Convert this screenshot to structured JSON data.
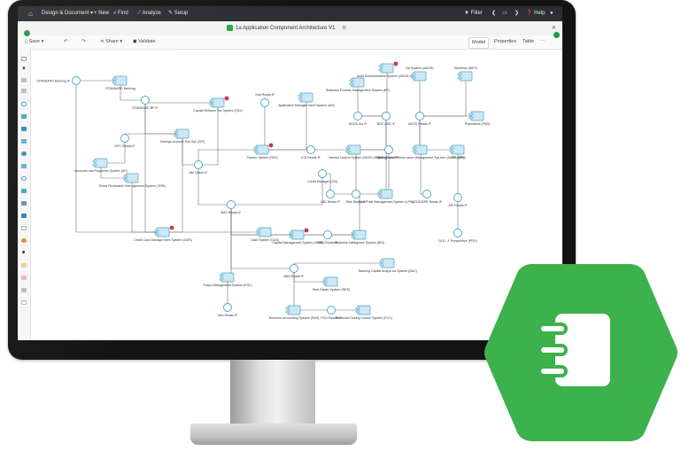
{
  "menu": {
    "design_label": "Design & Document",
    "new_label": "+ New",
    "find_label": "Find",
    "analyze_label": "Analyze",
    "setup_label": "Setup",
    "filter_label": "Filter",
    "help_label": "Help"
  },
  "tab": {
    "title": "1a Application Component Architecture V1"
  },
  "toolbar": {
    "save_label": "Save",
    "share_label": "Share",
    "validate_label": "Validate",
    "views": [
      "Model",
      "Properties",
      "Table"
    ]
  },
  "diagram": {
    "nodes": [
      "STANDARD Banking IF",
      "STANDARD Banking",
      "STANDARD BP IF",
      "Capital Reforms Tax System (TAX)",
      "Application Manager ment System (AM)",
      "Yost Reads IF",
      "Audit Documentation System (ADOS-AUD)",
      "Business Process Management System (BP)",
      "BA System (ADOS)",
      "Workflow (WKF)",
      "ADOS-AU IF",
      "BDC ADD IF",
      "ADOS Reads IF",
      "Plannables (FND)",
      "DPC Reads IF",
      "Savings Account Sub Sys (SPI)",
      "Internal Control System (ADOS-ICS)",
      "Strategy and Perform ance Management Sys tem (ADOS-SPM)",
      "APH Reads IF",
      "API (API)",
      "Accounts and Payments System (AP)",
      "ICS Reads IF",
      "Partner System (PAS)",
      "AM Online IF",
      "Tiered Receivable Man agement System (TRR)",
      "Credit Manager (CM)",
      "LBD Reads IF",
      "ADOS-BPE Reads IF",
      "API Reads IF",
      "Risk Reads IF",
      "Lost Pride Management System (LPS)",
      "DLD - F Prospective (PRO)",
      "Credit Card Manage ment System (CMS)",
      "BAS Reads IF",
      "Cash System (CAS)",
      "Capital Management System (SMS)",
      "SMS Reads IF",
      "Business Intelligence System (BIS)",
      "Banking Capital Analys ics System (BAC)",
      "Policy Management System (POL)",
      "BAN Reads IF",
      "Real Estate System (RES)",
      "Non Reads IF",
      "Revenue Accounting System (RAS)",
      "PCD Reads IF",
      "Financial Closing Control System (FCC)"
    ]
  },
  "badge": {
    "icon": "notebook-icon",
    "color": "#3db14b"
  }
}
